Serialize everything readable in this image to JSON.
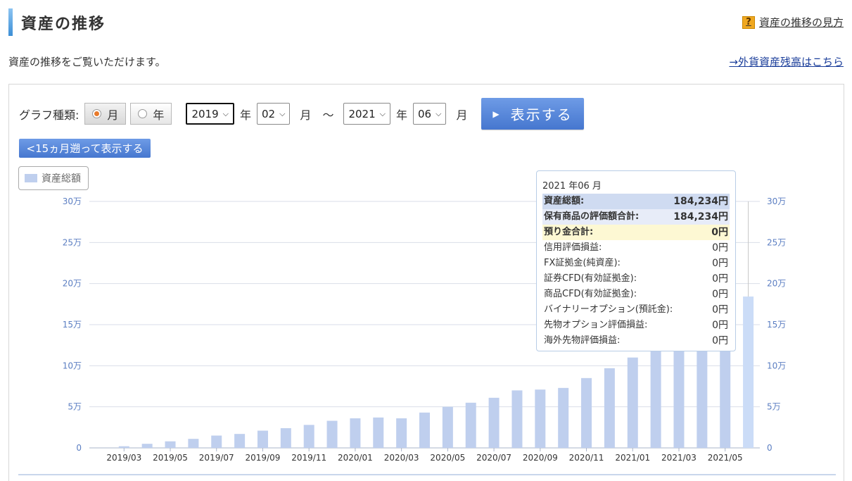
{
  "header": {
    "title": "資産の推移",
    "help_link": "資産の推移の見方",
    "help_icon": "question-icon",
    "description": "資産の推移をご覧いただけます。",
    "fx_link": "→外貨資産残高はこちら"
  },
  "controls": {
    "graph_type_label": "グラフ種類:",
    "radio_month": "月",
    "radio_year": "年",
    "selected_type": "月",
    "start_year": "2019",
    "start_month": "02",
    "end_year": "2021",
    "end_month": "06",
    "year_unit": "年",
    "month_unit": "月",
    "tilde": "～",
    "show_button": "表示する",
    "back_button": "<15ヵ月遡って表示する"
  },
  "legend": {
    "label": "資産総額"
  },
  "tooltip": {
    "date": "2021 年06 月",
    "rows": [
      {
        "label": "資産総額:",
        "value": "184,234円"
      },
      {
        "label": "保有商品の評価額合計:",
        "value": "184,234円"
      },
      {
        "label": "預り金合計:",
        "value": "0円"
      },
      {
        "label": "信用評価損益:",
        "value": "0円"
      },
      {
        "label": "FX証拠金(純資産):",
        "value": "0円"
      },
      {
        "label": "証券CFD(有効証拠金):",
        "value": "0円"
      },
      {
        "label": "商品CFD(有効証拠金):",
        "value": "0円"
      },
      {
        "label": "バイナリーオプション(預託金):",
        "value": "0円"
      },
      {
        "label": "先物オプション評価損益:",
        "value": "0円"
      },
      {
        "label": "海外先物評価損益:",
        "value": "0円"
      }
    ]
  },
  "colors": {
    "bar": "#bfcfee",
    "bar_highlight": "#cbdcf7",
    "grid": "#d9dee8",
    "axis_label": "#5b7ec2",
    "button": "#4d7fd6"
  },
  "chart_data": {
    "type": "bar",
    "categories": [
      "2019/02",
      "2019/03",
      "2019/04",
      "2019/05",
      "2019/06",
      "2019/07",
      "2019/08",
      "2019/09",
      "2019/10",
      "2019/11",
      "2019/12",
      "2020/01",
      "2020/02",
      "2020/03",
      "2020/04",
      "2020/05",
      "2020/06",
      "2020/07",
      "2020/08",
      "2020/09",
      "2020/10",
      "2020/11",
      "2020/12",
      "2021/01",
      "2021/02",
      "2021/03",
      "2021/04",
      "2021/05",
      "2021/06"
    ],
    "x_tick_labels": [
      "2019/03",
      "2019/05",
      "2019/07",
      "2019/09",
      "2019/11",
      "2020/01",
      "2020/03",
      "2020/05",
      "2020/07",
      "2020/09",
      "2020/11",
      "2021/01",
      "2021/03",
      "2021/05"
    ],
    "series": [
      {
        "name": "資産総額",
        "values": [
          0,
          2000,
          5000,
          8000,
          11000,
          15000,
          17000,
          21000,
          24000,
          28000,
          33000,
          36000,
          37000,
          36000,
          43000,
          50000,
          55000,
          61000,
          70000,
          71000,
          73000,
          85000,
          97000,
          110000,
          124000,
          142000,
          158000,
          170000,
          184234
        ]
      }
    ],
    "y_ticks": [
      0,
      50000,
      100000,
      150000,
      200000,
      250000,
      300000
    ],
    "y_tick_labels": [
      "0",
      "5万",
      "10万",
      "15万",
      "20万",
      "25万",
      "30万"
    ],
    "ylim": [
      0,
      300000
    ],
    "grid": true,
    "highlighted_index": 28
  }
}
